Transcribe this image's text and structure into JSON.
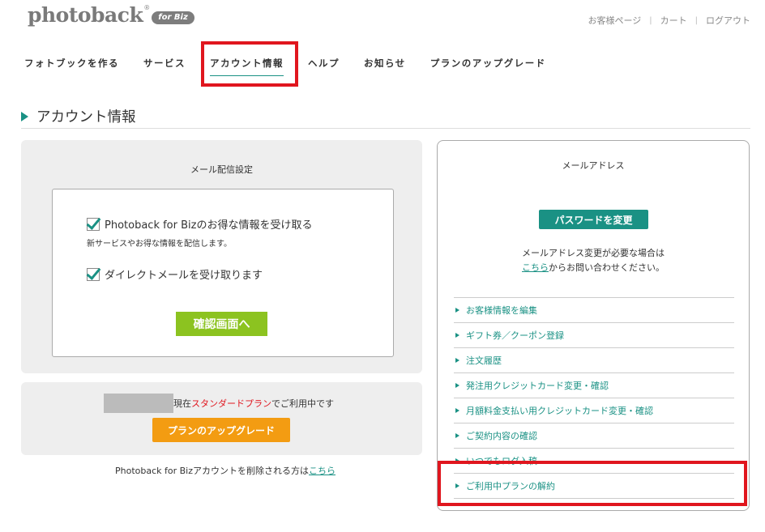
{
  "header": {
    "logo_text": "photoback",
    "logo_reg": "®",
    "logo_badge": "for Biz",
    "util_links": [
      "お客様ページ",
      "カート",
      "ログアウト"
    ],
    "util_sep": "|"
  },
  "nav": {
    "items": [
      "フォトブックを作る",
      "サービス",
      "アカウント情報",
      "ヘルプ",
      "お知らせ",
      "プランのアップグレード"
    ],
    "active_index": 2
  },
  "page_title": "アカウント情報",
  "mail_settings": {
    "title": "メール配信設定",
    "option1_label": "Photoback for Bizのお得な情報を受け取る",
    "option1_desc": "新サービスやお得な情報を配信します。",
    "option2_label": "ダイレクトメールを受け取ります",
    "confirm_button": "確認画面へ"
  },
  "plan": {
    "text_prefix": "現在",
    "plan_name": "スタンダードプラン",
    "text_suffix": "でご利用中です",
    "upgrade_button": "プランのアップグレード"
  },
  "delete_account": {
    "text": "Photoback for Bizアカウントを削除される方は",
    "link": "こちら"
  },
  "account_panel": {
    "title": "メールアドレス",
    "password_button": "パスワードを変更",
    "note_line1": "メールアドレス変更が必要な場合は",
    "note_link": "こちら",
    "note_line2": "からお問い合わせください。",
    "menu": [
      "お客様情報を編集",
      "ギフト券／クーポン登録",
      "注文履歴",
      "発注用クレジットカード変更・確認",
      "月額料金支払い用クレジットカード変更・確認",
      "ご契約内容の確認",
      "いつでもログ入稿",
      "ご利用中プランの解約"
    ]
  },
  "colors": {
    "accent": "#1a9184",
    "highlight": "#e0161e",
    "confirm_green": "#8cc320",
    "upgrade_orange": "#f39c12"
  }
}
